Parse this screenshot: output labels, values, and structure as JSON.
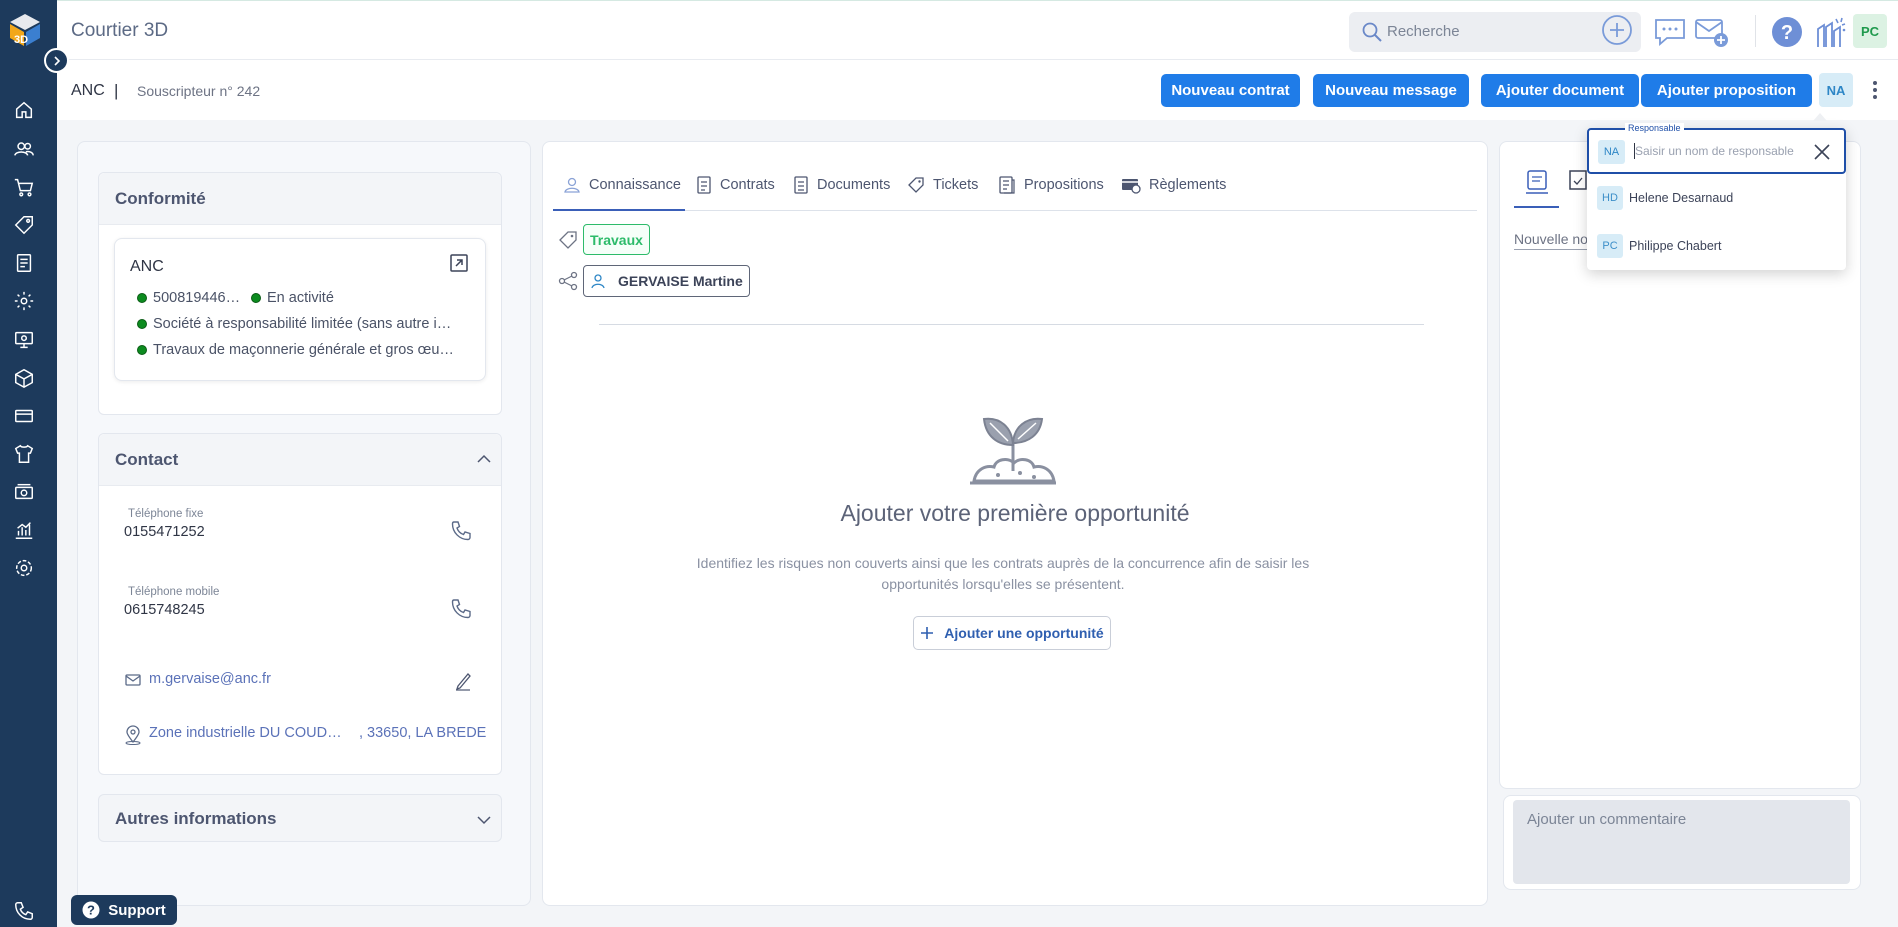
{
  "app": {
    "title": "Courtier 3D"
  },
  "search": {
    "placeholder": "Recherche"
  },
  "user": {
    "initials": "PC"
  },
  "breadcrumb": {
    "main": "ANC",
    "separator": "|",
    "sub": "Souscripteur n° 242"
  },
  "actions": {
    "new_contract": "Nouveau contrat",
    "new_message": "Nouveau message",
    "add_document": "Ajouter document",
    "add_proposal": "Ajouter proposition",
    "owner_initials": "NA"
  },
  "conformite": {
    "title": "Conformité",
    "company": "ANC",
    "siren": "500819446…",
    "status": "En activité",
    "legal_form": "Société à responsabilité limitée (sans autre i…",
    "activity": "Travaux de maçonnerie générale et gros œu…"
  },
  "contact": {
    "title": "Contact",
    "phone_fixed_label": "Téléphone fixe",
    "phone_fixed": "0155471252",
    "phone_mobile_label": "Téléphone mobile",
    "phone_mobile": "0615748245",
    "email": "m.gervaise@anc.fr",
    "address_line": "Zone industrielle DU COUD…",
    "address_city": ", 33650, LA BREDE"
  },
  "other": {
    "title": "Autres informations"
  },
  "tabs": [
    {
      "label": "Connaissance"
    },
    {
      "label": "Contrats"
    },
    {
      "label": "Documents"
    },
    {
      "label": "Tickets"
    },
    {
      "label": "Propositions"
    },
    {
      "label": "Règlements"
    }
  ],
  "tags": {
    "activity": "Travaux",
    "person": "GERVAISE Martine"
  },
  "empty_state": {
    "title": "Ajouter votre première opportunité",
    "description": "Identifiez les risques non couverts ainsi que les contrats auprès de la concurrence afin de saisir les opportunités lorsqu'elles se présentent.",
    "button": "Ajouter une opportunité"
  },
  "notes": {
    "partial_label": "Nouvelle no",
    "comment_placeholder": "Ajouter un commentaire"
  },
  "responsable": {
    "legend": "Responsable",
    "current_initials": "NA",
    "placeholder": "Saisir un nom de responsable",
    "options": [
      {
        "initials": "HD",
        "name": "Helene Desarnaud"
      },
      {
        "initials": "PC",
        "name": "Philippe Chabert"
      }
    ]
  },
  "support": {
    "label": "Support"
  },
  "colors": {
    "sidebar": "#1d3a5c",
    "primary": "#1f7ce8",
    "success": "#2dbb6a",
    "status_dot": "#0c8b1f"
  }
}
